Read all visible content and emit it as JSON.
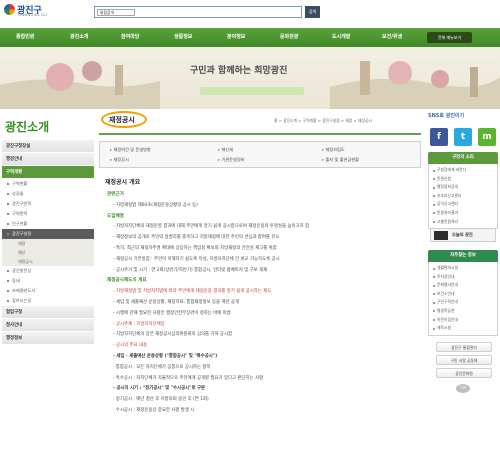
{
  "header": {
    "logo_title": "광진구",
    "logo_sub": "GWANGJIN-GU",
    "search_scope": "통합검색",
    "search_button": "검색"
  },
  "nav": {
    "items": [
      "종합민원",
      "광진소개",
      "참여마당",
      "생활정보",
      "분야정보",
      "문화관광",
      "도시개발",
      "보건/위생"
    ],
    "all_menu": "전체 메뉴보기"
  },
  "banner": {
    "slogan": "구민과 함께하는 희망광진"
  },
  "side": {
    "page_title": "광진소개",
    "items": [
      {
        "label": "광진구청장실",
        "type": "item"
      },
      {
        "label": "행정안내",
        "type": "item"
      },
      {
        "label": "구역개황",
        "type": "item-active"
      },
      {
        "label": "구역현황",
        "type": "sub"
      },
      {
        "label": "상징물",
        "type": "sub"
      },
      {
        "label": "광진구연혁",
        "type": "sub"
      },
      {
        "label": "구역면적",
        "type": "sub"
      },
      {
        "label": "인구현황",
        "type": "sub"
      },
      {
        "label": "광진구실정",
        "type": "sub-dark"
      },
      {
        "label": "재정",
        "type": "sub3"
      },
      {
        "label": "예산",
        "type": "sub3"
      },
      {
        "label": "재정공시",
        "type": "sub3"
      },
      {
        "label": "광진발전상",
        "type": "sub"
      },
      {
        "label": "동네",
        "type": "sub"
      },
      {
        "label": "자매결연도시",
        "type": "sub"
      },
      {
        "label": "찾아오는길",
        "type": "sub"
      },
      {
        "label": "협업구청",
        "type": "item"
      },
      {
        "label": "청사안내",
        "type": "item"
      },
      {
        "label": "행정정보",
        "type": "item"
      }
    ]
  },
  "content": {
    "title": "재정공시",
    "breadcrumb": "홈 > 광진소개 > 구역개황 > 광진구실정 > 재정 > 재정공시",
    "subnav": [
      "재정여건 및 운영방향",
      "재산세",
      "재정자립도",
      "재정공시",
      "기관운영경비",
      "출자 및 출연금현황"
    ],
    "section_title": "재정공시 개요",
    "lines": [
      {
        "text": "관련근거",
        "style": "h-green"
      },
      {
        "text": "- 지방재정법 제60조(재정운용상황의 공시 등)",
        "style": "txt"
      },
      {
        "text": "도입배경",
        "style": "h-green"
      },
      {
        "text": "- 지방자치단체의 재정운영 결과에 대해 주민에게 알기 쉽게 공시함으로써 재정운용의 투명성을 높이고자 함",
        "style": "txt"
      },
      {
        "text": "- 재정정보의 공개로 주민의 알권리를 충족하고 지방재정에 대한 주민의 관심과 참여를 유도",
        "style": "txt"
      },
      {
        "text": "- 특히, 최근의 재정자주권 확대에 상응하는 책임성 확보와 지방재정의 건전성 제고를 위함",
        "style": "txt"
      },
      {
        "text": "- 재정공시 기본방침 : 주민이 이해하기 쉽도록 작성, 지방자치단체 간 비교 가능하도록 공시",
        "style": "txt"
      },
      {
        "text": "- 공시주기 및 시기 : 연 2회(상반기/하반기) 통합공시, 인터넷 홈페이지 및 구보 게재",
        "style": "txt"
      },
      {
        "text": "재정공시제도의 개요",
        "style": "h-green"
      },
      {
        "text": "- 지방재정법 및 지방자치법에 따라 주민에게 재정운용 결과를 알기 쉽게 공시하는 제도",
        "style": "txt red"
      },
      {
        "text": "- 세입 및 세출예산 운용상황, 재정지표, 통합재정정보 등을 매년 공개",
        "style": "txt"
      },
      {
        "text": "- 시행에 관해 필요한 사항은 행정안전부장관이 정하는 바에 따름",
        "style": "txt"
      },
      {
        "text": "- 공시주체 : 지방자치단체장",
        "style": "txt red"
      },
      {
        "text": "- 지방자치단체의 장은 재정공시심의위원회의 심의를 거쳐 공시함",
        "style": "txt"
      },
      {
        "text": "- 공시의 주요 내용",
        "style": "txt red"
      },
      {
        "text": "- 세입 · 세출예산 운용상황 (\"통합공시\" 및 \"특수공시\")",
        "style": "txt bold"
      },
      {
        "text": "   · 통합공시 : 모든 자치단체가 공통으로 공시하는 항목",
        "style": "txt"
      },
      {
        "text": "   · 특수공시 : 자치단체가 자율적으로 주민에게 공개할 필요가 있다고 판단하는 사항",
        "style": "txt"
      },
      {
        "text": "- 공시의 시기 : \"정기공시\" 및 \"수시공시\"로 구분",
        "style": "txt bold"
      },
      {
        "text": "   · 정기공시 : 매년 결산 후 지방의회 승인 후 (연 1회)",
        "style": "txt"
      },
      {
        "text": "   · 수시공시 : 재정운용상 중요한 사항 발생 시",
        "style": "txt"
      }
    ]
  },
  "right": {
    "sns_title": "SNS로 광진이기",
    "sns": [
      {
        "icon": "facebook-icon",
        "glyph": "f",
        "color": "#3b5998"
      },
      {
        "icon": "twitter-icon",
        "glyph": "t",
        "color": "#29a9e0"
      },
      {
        "icon": "me2day-icon",
        "glyph": "m",
        "color": "#5cb531"
      }
    ],
    "box1_title": "구민의 소리",
    "box1_color": "#5c9a3c",
    "box1_lines": [
      "구청장에게 바란다",
      "민원신청",
      "행정정보공개",
      "부조리신고센터",
      "공익신고센터",
      "민원처리결과",
      "고충민원처리"
    ],
    "video_label": "오늘의 광진",
    "box2_title": "자주찾는 정보",
    "box2_color": "#2f8a4e",
    "box2_lines": [
      "생활편의시설",
      "주차장안내",
      "문화행사안내",
      "보건소안내",
      "구인구직안내",
      "평생학습관",
      "어린이집안내",
      "체육시설"
    ],
    "btn1": "광진구 통합관리",
    "btn2": "구민 사랑 공동체",
    "btn3": "광진문화원",
    "top": "TOP"
  }
}
